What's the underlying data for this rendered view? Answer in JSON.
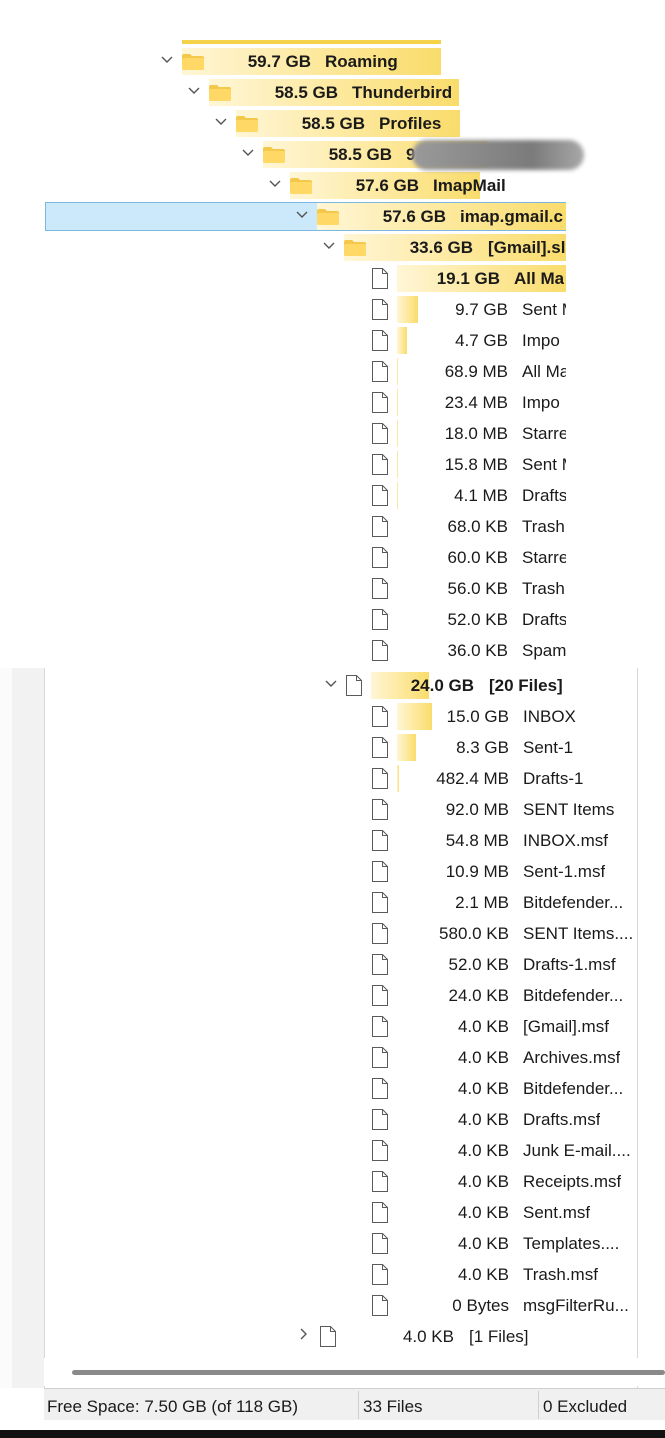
{
  "colors": {
    "bar": "#f9dc6c",
    "selection": "#cce8fb",
    "folder": "#f3c84b"
  },
  "tree": [
    {
      "type": "folder",
      "size": "59.7 GB",
      "name": "Roaming",
      "bold": true
    },
    {
      "type": "folder",
      "size": "58.5 GB",
      "name": "Thunderbird",
      "bold": true
    },
    {
      "type": "folder",
      "size": "58.5 GB",
      "name": "Profiles",
      "bold": true
    },
    {
      "type": "folder",
      "size": "58.5 GB",
      "name": "9",
      "bold": true
    },
    {
      "type": "folder",
      "size": "57.6 GB",
      "name": "ImapMail",
      "bold": true
    },
    {
      "type": "folder",
      "size": "57.6 GB",
      "name": "imap.gmail.c",
      "bold": true,
      "selected": true
    },
    {
      "type": "folder",
      "size": "33.6 GB",
      "name": "[Gmail].sl",
      "bold": true
    },
    {
      "type": "file",
      "size": "19.1 GB",
      "name": "All Ma",
      "bold": true
    },
    {
      "type": "file",
      "size": "9.7 GB",
      "name": "Sent M"
    },
    {
      "type": "file",
      "size": "4.7 GB",
      "name": "Impo"
    },
    {
      "type": "file",
      "size": "68.9 MB",
      "name": "All Ma"
    },
    {
      "type": "file",
      "size": "23.4 MB",
      "name": "Impo"
    },
    {
      "type": "file",
      "size": "18.0 MB",
      "name": "Starre"
    },
    {
      "type": "file",
      "size": "15.8 MB",
      "name": "Sent M"
    },
    {
      "type": "file",
      "size": "4.1 MB",
      "name": "Drafts"
    },
    {
      "type": "file",
      "size": "68.0 KB",
      "name": "Trash"
    },
    {
      "type": "file",
      "size": "60.0 KB",
      "name": "Starre"
    },
    {
      "type": "file",
      "size": "56.0 KB",
      "name": "Trash."
    },
    {
      "type": "file",
      "size": "52.0 KB",
      "name": "Drafts"
    },
    {
      "type": "file",
      "size": "36.0 KB",
      "name": "Spam"
    },
    {
      "type": "files",
      "size": "24.0 GB",
      "name": "[20 Files]",
      "bold": true
    },
    {
      "type": "file",
      "size": "15.0 GB",
      "name": "INBOX"
    },
    {
      "type": "file",
      "size": "8.3 GB",
      "name": "Sent-1"
    },
    {
      "type": "file",
      "size": "482.4 MB",
      "name": "Drafts-1"
    },
    {
      "type": "file",
      "size": "92.0 MB",
      "name": "SENT Items"
    },
    {
      "type": "file",
      "size": "54.8 MB",
      "name": "INBOX.msf"
    },
    {
      "type": "file",
      "size": "10.9 MB",
      "name": "Sent-1.msf"
    },
    {
      "type": "file",
      "size": "2.1 MB",
      "name": "Bitdefender..."
    },
    {
      "type": "file",
      "size": "580.0 KB",
      "name": "SENT Items...."
    },
    {
      "type": "file",
      "size": "52.0 KB",
      "name": "Drafts-1.msf"
    },
    {
      "type": "file",
      "size": "24.0 KB",
      "name": "Bitdefender..."
    },
    {
      "type": "file",
      "size": "4.0 KB",
      "name": "[Gmail].msf"
    },
    {
      "type": "file",
      "size": "4.0 KB",
      "name": "Archives.msf"
    },
    {
      "type": "file",
      "size": "4.0 KB",
      "name": "Bitdefender..."
    },
    {
      "type": "file",
      "size": "4.0 KB",
      "name": "Drafts.msf"
    },
    {
      "type": "file",
      "size": "4.0 KB",
      "name": "Junk E-mail...."
    },
    {
      "type": "file",
      "size": "4.0 KB",
      "name": "Receipts.msf"
    },
    {
      "type": "file",
      "size": "4.0 KB",
      "name": "Sent.msf"
    },
    {
      "type": "file",
      "size": "4.0 KB",
      "name": "Templates...."
    },
    {
      "type": "file",
      "size": "4.0 KB",
      "name": "Trash.msf"
    },
    {
      "type": "file",
      "size": "0 Bytes",
      "name": "msgFilterRu..."
    },
    {
      "type": "files",
      "size": "4.0 KB",
      "name": "[1 Files]",
      "collapsed": true
    }
  ],
  "status": {
    "free_space": "Free Space: 7.50 GB  (of 118 GB)",
    "files": "33 Files",
    "excluded": "0 Excluded"
  }
}
